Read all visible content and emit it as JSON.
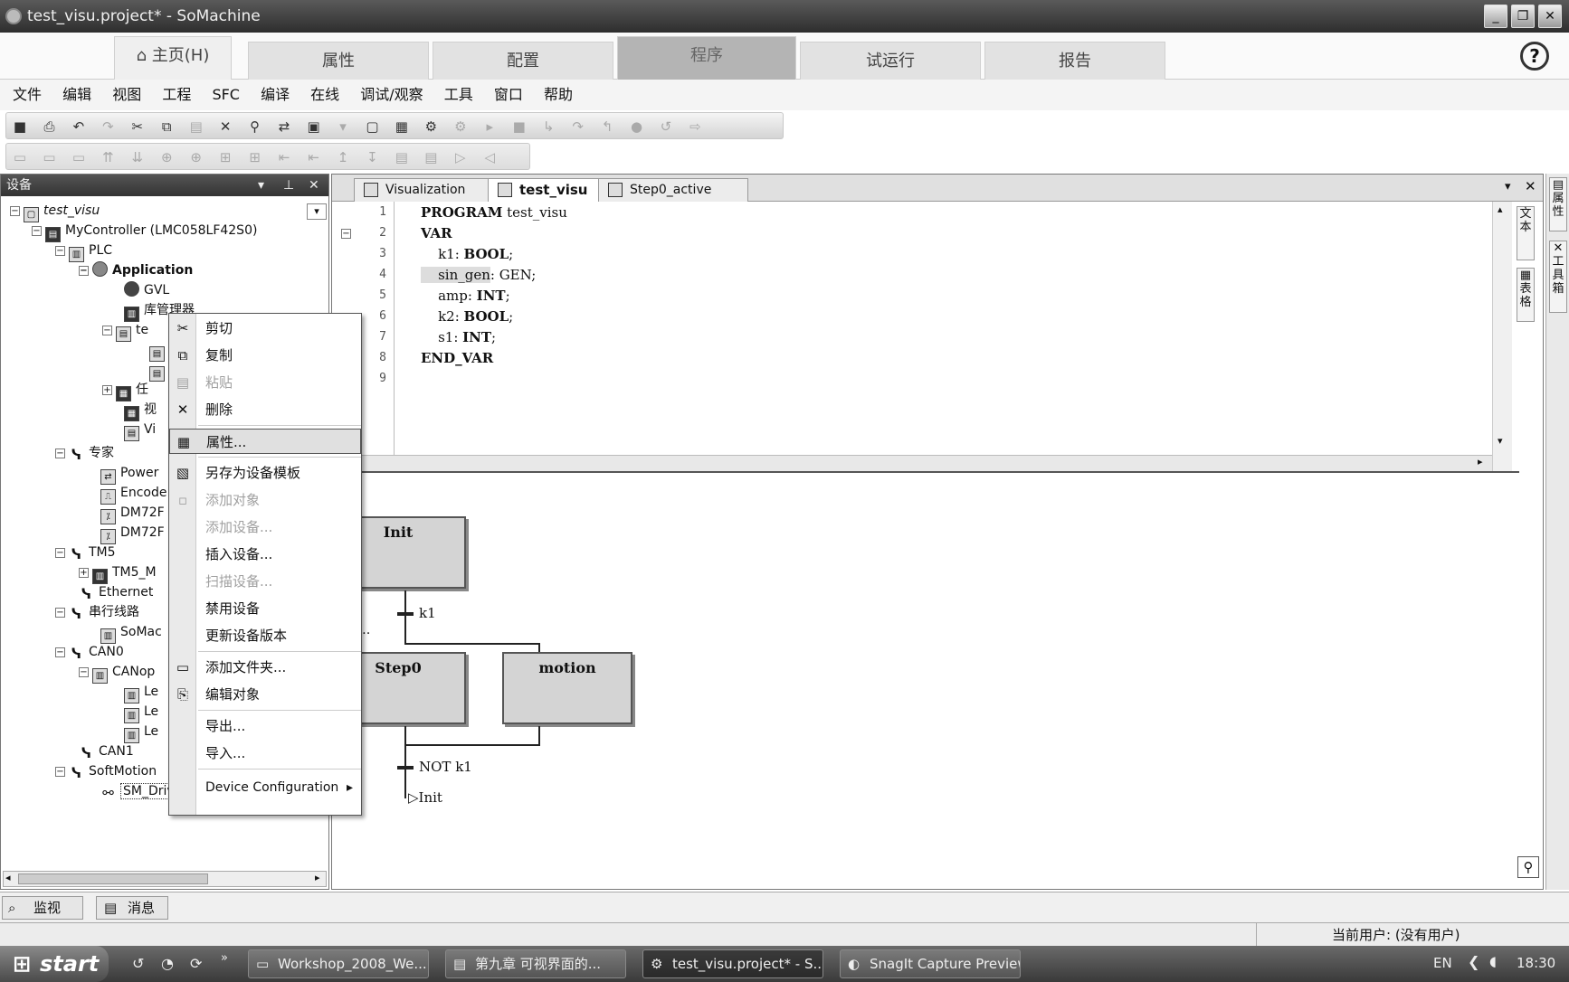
{
  "window": {
    "title": "test_visu.project* - SoMachine"
  },
  "ribbon": {
    "home_label": "主页(H)",
    "tabs": [
      "属性",
      "配置",
      "程序",
      "试运行",
      "报告"
    ],
    "help_label": "?"
  },
  "menubar": [
    "文件",
    "编辑",
    "视图",
    "工程",
    "SFC",
    "编译",
    "在线",
    "调试/观察",
    "工具",
    "窗口",
    "帮助"
  ],
  "devices_panel": {
    "header": "设备",
    "tree": [
      "test_visu",
      "MyController (LMC058LF42S0)",
      "PLC",
      "Application",
      "GVL",
      "库管理器",
      "te",
      "任",
      "视",
      "Vi",
      "专家",
      "Power",
      "Encode",
      "DM72F",
      "DM72F",
      "TM5",
      "TM5_M",
      "Ethernet",
      "串行线路",
      "SoMac",
      "CAN0",
      "CANop",
      "Le",
      "Le",
      "Le",
      "CAN1",
      "SoftMotion",
      "SM_Drive_Virtual (SM_Drive_Virtu"
    ]
  },
  "context_menu": {
    "items": [
      {
        "label": "剪切",
        "icon": "scissors-icon",
        "glyph": "✂"
      },
      {
        "label": "复制",
        "icon": "copy-icon",
        "glyph": "⧉"
      },
      {
        "label": "粘贴",
        "icon": "paste-icon",
        "glyph": "▤"
      },
      {
        "label": "删除",
        "icon": "delete-icon",
        "glyph": "✕"
      },
      {
        "label": "属性...",
        "icon": "properties-icon",
        "glyph": "▦"
      },
      {
        "label": "另存为设备模板",
        "icon": "save-template-icon",
        "glyph": "▧"
      },
      {
        "label": "添加对象",
        "icon": "add-object-icon",
        "glyph": "▫"
      },
      {
        "label": "添加设备...",
        "icon": "",
        "glyph": ""
      },
      {
        "label": "插入设备...",
        "icon": "",
        "glyph": ""
      },
      {
        "label": "扫描设备...",
        "icon": "",
        "glyph": ""
      },
      {
        "label": "禁用设备",
        "icon": "",
        "glyph": ""
      },
      {
        "label": "更新设备版本",
        "icon": "",
        "glyph": ""
      },
      {
        "label": "添加文件夹...",
        "icon": "folder-icon",
        "glyph": "▭"
      },
      {
        "label": "编辑对象",
        "icon": "edit-object-icon",
        "glyph": "⎘"
      },
      {
        "label": "导出...",
        "icon": "",
        "glyph": ""
      },
      {
        "label": "导入...",
        "icon": "",
        "glyph": ""
      },
      {
        "label": "Device Configuration",
        "icon": "",
        "glyph": ""
      }
    ],
    "submenu_arrow": "▸"
  },
  "editor": {
    "tabs": [
      "Visualization",
      "test_visu",
      "Step0_active"
    ],
    "active_tab": "test_visu",
    "line_numbers": [
      "1",
      "2",
      "3",
      "4",
      "5",
      "6",
      "7",
      "8",
      "9"
    ],
    "code": {
      "l1_kw": "PROGRAM",
      "l1_rest": " test_visu",
      "l2_kw": "VAR",
      "l3_name": "    k1: ",
      "l3_type": "BOOL",
      "l3_end": ";",
      "l4_name": "    sin_gen",
      "l4_rest": ": GEN;",
      "l5_name": "    amp: ",
      "l5_type": "INT",
      "l5_end": ";",
      "l6_name": "    k2: ",
      "l6_type": "BOOL",
      "l6_end": ";",
      "l7_name": "    s1: ",
      "l7_type": "INT",
      "l7_end": ";",
      "l8_kw": "END_VAR"
    }
  },
  "sfc": {
    "step_init": "Init",
    "transition_k1": "k1",
    "branch_label": "Bran…",
    "step_step0": "Step0",
    "step_motion": "motion",
    "transition_not_k1": "NOT k1",
    "jump_target": "Init"
  },
  "right_sidebar": {
    "tab1": "属性",
    "tab2": "工具箱",
    "tab3": "文本",
    "tab4": "表格"
  },
  "bottom_tabs": [
    "监视 1",
    "消息"
  ],
  "status": {
    "current_user": "当前用户: (没有用户)"
  },
  "taskbar": {
    "start": "start",
    "tasks": [
      "Workshop_2008_We...",
      "第九章 可视界面的...",
      "test_visu.project* - S...",
      "SnagIt Capture Preview"
    ],
    "language": "EN",
    "clock": "18:30"
  }
}
